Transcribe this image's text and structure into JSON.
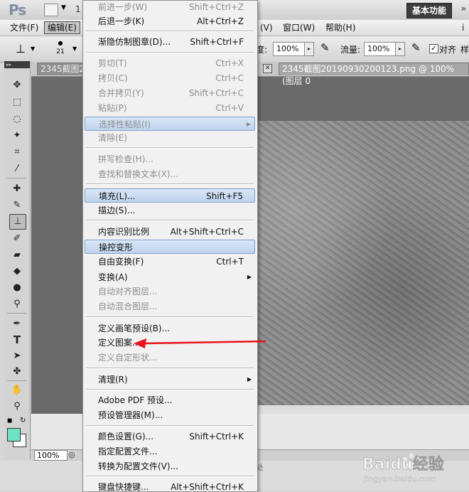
{
  "menubar": {
    "items": [
      {
        "label": "文件(F)"
      },
      {
        "label": "编辑(E)"
      },
      {
        "label": "(V)"
      },
      {
        "label": "窗口(W)"
      },
      {
        "label": "帮助(H)"
      },
      {
        "label": "i"
      }
    ]
  },
  "appbar": {
    "logo": "Ps",
    "workspace": "基本功能",
    "more": "»"
  },
  "options": {
    "brush_size": "21",
    "opacity_label": "度:",
    "opacity_value": "100%",
    "flow_label": "流量:",
    "flow_value": "100%",
    "align_label": "对齐",
    "sample_label": "样"
  },
  "document": {
    "tab1": "2345截图2",
    "tab2": "2345截图20190930200123.png @ 100% (图层 0",
    "zoom": "100%",
    "status_tail": "处"
  },
  "menu": {
    "items": [
      {
        "label": "前进一步(W)",
        "shortcut": "Shift+Ctrl+Z",
        "state": "disabled"
      },
      {
        "label": "后退一步(K)",
        "shortcut": "Alt+Ctrl+Z",
        "state": "enabled"
      },
      {
        "label": "渐隐仿制图章(D)...",
        "shortcut": "Shift+Ctrl+F",
        "state": "enabled"
      },
      {
        "label": "剪切(T)",
        "shortcut": "Ctrl+X",
        "state": "disabled"
      },
      {
        "label": "拷贝(C)",
        "shortcut": "Ctrl+C",
        "state": "disabled"
      },
      {
        "label": "合并拷贝(Y)",
        "shortcut": "Shift+Ctrl+C",
        "state": "disabled"
      },
      {
        "label": "粘贴(P)",
        "shortcut": "Ctrl+V",
        "state": "disabled"
      },
      {
        "label": "选择性粘贴(I)",
        "shortcut": "",
        "state": "disabled-highlight",
        "submenu": true
      },
      {
        "label": "清除(E)",
        "shortcut": "",
        "state": "disabled"
      },
      {
        "label": "拼写检查(H)...",
        "shortcut": "",
        "state": "disabled"
      },
      {
        "label": "查找和替换文本(X)...",
        "shortcut": "",
        "state": "disabled"
      },
      {
        "label": "填充(L)...",
        "shortcut": "Shift+F5",
        "state": "highlight"
      },
      {
        "label": "描边(S)...",
        "shortcut": "",
        "state": "enabled"
      },
      {
        "label": "内容识别比例",
        "shortcut": "Alt+Shift+Ctrl+C",
        "state": "enabled"
      },
      {
        "label": "操控变形",
        "shortcut": "",
        "state": "highlight"
      },
      {
        "label": "自由变换(F)",
        "shortcut": "Ctrl+T",
        "state": "enabled"
      },
      {
        "label": "变换(A)",
        "shortcut": "",
        "state": "enabled",
        "submenu": true
      },
      {
        "label": "自动对齐图层...",
        "shortcut": "",
        "state": "disabled"
      },
      {
        "label": "自动混合图层...",
        "shortcut": "",
        "state": "disabled"
      },
      {
        "label": "定义画笔预设(B)...",
        "shortcut": "",
        "state": "enabled"
      },
      {
        "label": "定义图案...",
        "shortcut": "",
        "state": "enabled"
      },
      {
        "label": "定义自定形状...",
        "shortcut": "",
        "state": "disabled"
      },
      {
        "label": "清理(R)",
        "shortcut": "",
        "state": "enabled",
        "submenu": true
      },
      {
        "label": "Adobe PDF 预设...",
        "shortcut": "",
        "state": "enabled"
      },
      {
        "label": "预设管理器(M)...",
        "shortcut": "",
        "state": "enabled"
      },
      {
        "label": "颜色设置(G)...",
        "shortcut": "Shift+Ctrl+K",
        "state": "enabled"
      },
      {
        "label": "指定配置文件...",
        "shortcut": "",
        "state": "enabled"
      },
      {
        "label": "转换为配置文件(V)...",
        "shortcut": "",
        "state": "enabled"
      },
      {
        "label": "键盘快捷键...",
        "shortcut": "Alt+Shift+Ctrl+K",
        "state": "enabled"
      }
    ]
  },
  "colors": {
    "foreground": "#6de3c4",
    "background": "#ffffff",
    "arrow": "#e8141a"
  },
  "watermark": {
    "text": "Baidu经验",
    "url": "jingyan.baidu.com"
  }
}
